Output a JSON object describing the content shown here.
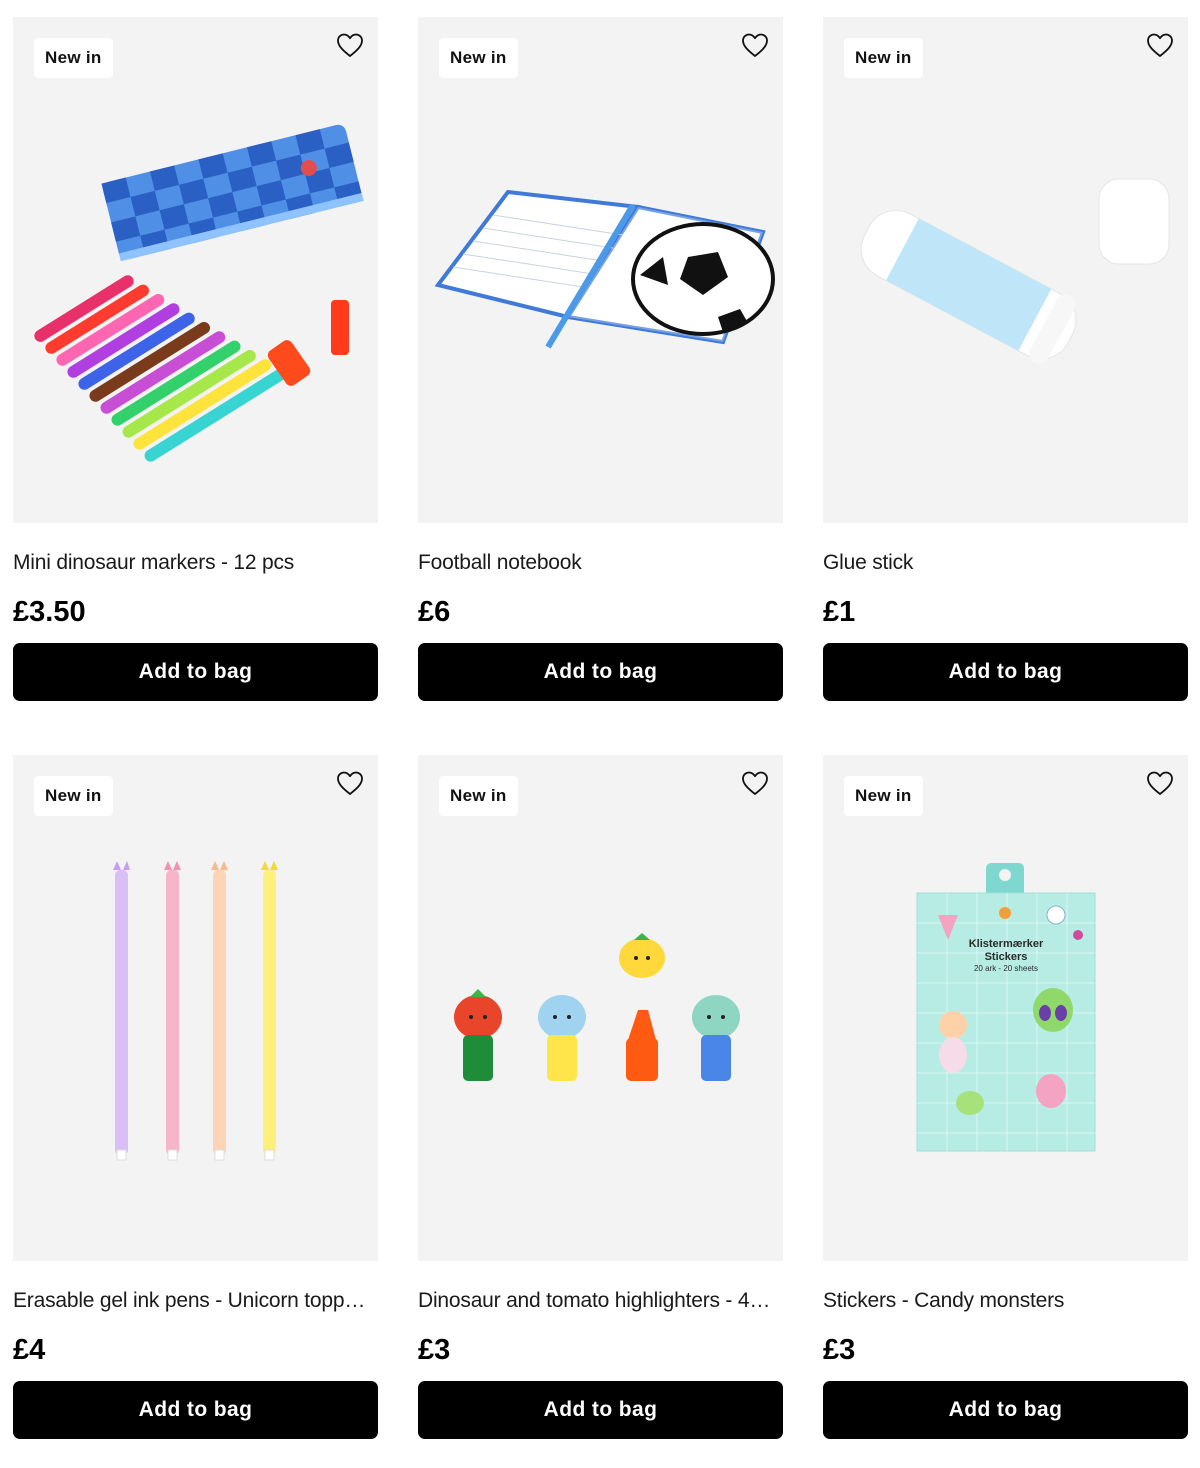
{
  "colors": {
    "accent_button": "#000000",
    "button_text": "#ffffff",
    "image_bg": "#f3f3f3",
    "badge_bg": "#ffffff"
  },
  "icons": {
    "wishlist": "heart-outline-icon"
  },
  "products": [
    {
      "badge": "New in",
      "name": "Mini dinosaur markers - 12 pcs",
      "price": "£3.50",
      "cta": "Add to bag",
      "image": "markers-and-checkered-pouch"
    },
    {
      "badge": "New in",
      "name": "Football notebook",
      "price": "£6",
      "cta": "Add to bag",
      "image": "open-football-notebook"
    },
    {
      "badge": "New in",
      "name": "Glue stick",
      "price": "£1",
      "cta": "Add to bag",
      "image": "glue-stick"
    },
    {
      "badge": "New in",
      "name": "Erasable gel ink pens - Unicorn topp…",
      "price": "£4",
      "cta": "Add to bag",
      "image": "four-pastel-pens"
    },
    {
      "badge": "New in",
      "name": "Dinosaur and tomato highlighters - 4…",
      "price": "£3",
      "cta": "Add to bag",
      "image": "character-highlighters"
    },
    {
      "badge": "New in",
      "name": "Stickers - Candy monsters",
      "price": "£3",
      "cta": "Add to bag",
      "image": "sticker-pack",
      "image_text": {
        "line1": "Klistermærker",
        "line2": "Stickers",
        "line3": "20 ark - 20 sheets"
      }
    }
  ]
}
